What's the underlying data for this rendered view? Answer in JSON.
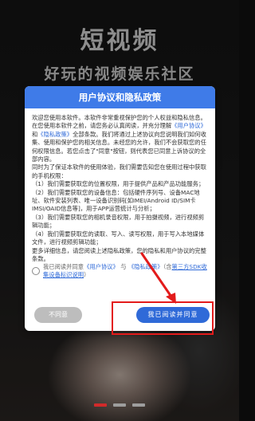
{
  "background": {
    "title": "短视频",
    "subtitle": "好玩的视频娱乐社区"
  },
  "dialog": {
    "title": "用户协议和隐私政策",
    "intro_1": "欢迎您使用本软件。本软件非常重视保护您的个人权益和隐私信息。 在您使用本软件之前，请您务必认真阅读，并充分理解",
    "intro_link_1": "《用户协议》",
    "intro_and": "和",
    "intro_link_2": "《隐私政策》",
    "intro_2": "全部条款。我们将通过上述协议向您说明我们如何收集、使用和保护您的相关信息。未经您的允许，我们不会获取您的任何权限信息。若您点击了\"同意\"按钮，则代表您已同意上诉协议的全部内容。",
    "para_2": "同时为了保证本软件的使用体验，我们需要告知您在使用过程中获取的手机权限：",
    "item_1": "（1）我们需要获取您的位置权限，用于提供产品和产品功能服务；",
    "item_2": "（2）我们需要获取您的设备信息：包括硬件序列号、设备MAC地址、软件安装列表、唯一设备识别码[如IMEI/Android ID/SIM卡IMSI/OAID信息等]，用于APP运营统计与分析；",
    "item_3": "（3）我们需要获取您的相机录音权限，用于拍摄视频，进行视频剪辑功能；",
    "item_4": "（4）我们需要获取您的读取、写入、读写权限，用于写入本地媒体文件，进行视频剪辑功能；",
    "item_5": "更多详细信息，请您阅读上述隐私政策，您的隐私和用户协议的完整条款。",
    "consent_prefix": "我已阅读并同意",
    "consent_link_1": "《用户协议》",
    "consent_and": "与",
    "consent_link_2": "《隐私政策》",
    "consent_suffix_1": "（含",
    "consent_third_party": "第三方SDK收集设备标识说明",
    "consent_suffix_2": "）",
    "disagree_label": "不同意",
    "agree_label": "我已阅读并同意"
  },
  "pager": {
    "total": 3,
    "active": 1
  },
  "colors": {
    "header_blue": "#3f7be8",
    "agree_button": "#2f6ad8",
    "disagree_button": "#bdbdbd",
    "annotation_red": "#e31b1b",
    "active_dot": "#d22a2a"
  }
}
